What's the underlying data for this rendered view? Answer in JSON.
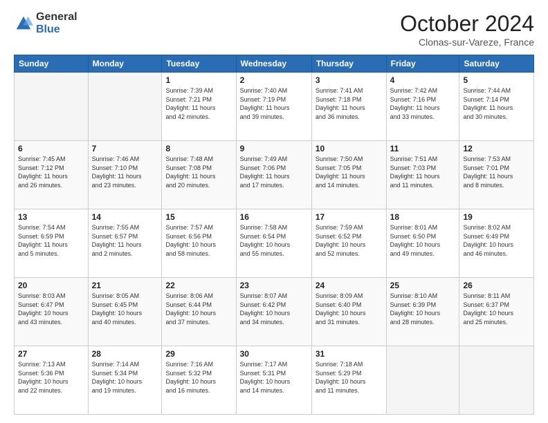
{
  "logo": {
    "general": "General",
    "blue": "Blue"
  },
  "header": {
    "month": "October 2024",
    "location": "Clonas-sur-Vareze, France"
  },
  "weekdays": [
    "Sunday",
    "Monday",
    "Tuesday",
    "Wednesday",
    "Thursday",
    "Friday",
    "Saturday"
  ],
  "weeks": [
    [
      {
        "num": "",
        "detail": ""
      },
      {
        "num": "",
        "detail": ""
      },
      {
        "num": "1",
        "detail": "Sunrise: 7:39 AM\nSunset: 7:21 PM\nDaylight: 11 hours\nand 42 minutes."
      },
      {
        "num": "2",
        "detail": "Sunrise: 7:40 AM\nSunset: 7:19 PM\nDaylight: 11 hours\nand 39 minutes."
      },
      {
        "num": "3",
        "detail": "Sunrise: 7:41 AM\nSunset: 7:18 PM\nDaylight: 11 hours\nand 36 minutes."
      },
      {
        "num": "4",
        "detail": "Sunrise: 7:42 AM\nSunset: 7:16 PM\nDaylight: 11 hours\nand 33 minutes."
      },
      {
        "num": "5",
        "detail": "Sunrise: 7:44 AM\nSunset: 7:14 PM\nDaylight: 11 hours\nand 30 minutes."
      }
    ],
    [
      {
        "num": "6",
        "detail": "Sunrise: 7:45 AM\nSunset: 7:12 PM\nDaylight: 11 hours\nand 26 minutes."
      },
      {
        "num": "7",
        "detail": "Sunrise: 7:46 AM\nSunset: 7:10 PM\nDaylight: 11 hours\nand 23 minutes."
      },
      {
        "num": "8",
        "detail": "Sunrise: 7:48 AM\nSunset: 7:08 PM\nDaylight: 11 hours\nand 20 minutes."
      },
      {
        "num": "9",
        "detail": "Sunrise: 7:49 AM\nSunset: 7:06 PM\nDaylight: 11 hours\nand 17 minutes."
      },
      {
        "num": "10",
        "detail": "Sunrise: 7:50 AM\nSunset: 7:05 PM\nDaylight: 11 hours\nand 14 minutes."
      },
      {
        "num": "11",
        "detail": "Sunrise: 7:51 AM\nSunset: 7:03 PM\nDaylight: 11 hours\nand 11 minutes."
      },
      {
        "num": "12",
        "detail": "Sunrise: 7:53 AM\nSunset: 7:01 PM\nDaylight: 11 hours\nand 8 minutes."
      }
    ],
    [
      {
        "num": "13",
        "detail": "Sunrise: 7:54 AM\nSunset: 6:59 PM\nDaylight: 11 hours\nand 5 minutes."
      },
      {
        "num": "14",
        "detail": "Sunrise: 7:55 AM\nSunset: 6:57 PM\nDaylight: 11 hours\nand 2 minutes."
      },
      {
        "num": "15",
        "detail": "Sunrise: 7:57 AM\nSunset: 6:56 PM\nDaylight: 10 hours\nand 58 minutes."
      },
      {
        "num": "16",
        "detail": "Sunrise: 7:58 AM\nSunset: 6:54 PM\nDaylight: 10 hours\nand 55 minutes."
      },
      {
        "num": "17",
        "detail": "Sunrise: 7:59 AM\nSunset: 6:52 PM\nDaylight: 10 hours\nand 52 minutes."
      },
      {
        "num": "18",
        "detail": "Sunrise: 8:01 AM\nSunset: 6:50 PM\nDaylight: 10 hours\nand 49 minutes."
      },
      {
        "num": "19",
        "detail": "Sunrise: 8:02 AM\nSunset: 6:49 PM\nDaylight: 10 hours\nand 46 minutes."
      }
    ],
    [
      {
        "num": "20",
        "detail": "Sunrise: 8:03 AM\nSunset: 6:47 PM\nDaylight: 10 hours\nand 43 minutes."
      },
      {
        "num": "21",
        "detail": "Sunrise: 8:05 AM\nSunset: 6:45 PM\nDaylight: 10 hours\nand 40 minutes."
      },
      {
        "num": "22",
        "detail": "Sunrise: 8:06 AM\nSunset: 6:44 PM\nDaylight: 10 hours\nand 37 minutes."
      },
      {
        "num": "23",
        "detail": "Sunrise: 8:07 AM\nSunset: 6:42 PM\nDaylight: 10 hours\nand 34 minutes."
      },
      {
        "num": "24",
        "detail": "Sunrise: 8:09 AM\nSunset: 6:40 PM\nDaylight: 10 hours\nand 31 minutes."
      },
      {
        "num": "25",
        "detail": "Sunrise: 8:10 AM\nSunset: 6:39 PM\nDaylight: 10 hours\nand 28 minutes."
      },
      {
        "num": "26",
        "detail": "Sunrise: 8:11 AM\nSunset: 6:37 PM\nDaylight: 10 hours\nand 25 minutes."
      }
    ],
    [
      {
        "num": "27",
        "detail": "Sunrise: 7:13 AM\nSunset: 5:36 PM\nDaylight: 10 hours\nand 22 minutes."
      },
      {
        "num": "28",
        "detail": "Sunrise: 7:14 AM\nSunset: 5:34 PM\nDaylight: 10 hours\nand 19 minutes."
      },
      {
        "num": "29",
        "detail": "Sunrise: 7:16 AM\nSunset: 5:32 PM\nDaylight: 10 hours\nand 16 minutes."
      },
      {
        "num": "30",
        "detail": "Sunrise: 7:17 AM\nSunset: 5:31 PM\nDaylight: 10 hours\nand 14 minutes."
      },
      {
        "num": "31",
        "detail": "Sunrise: 7:18 AM\nSunset: 5:29 PM\nDaylight: 10 hours\nand 11 minutes."
      },
      {
        "num": "",
        "detail": ""
      },
      {
        "num": "",
        "detail": ""
      }
    ]
  ]
}
